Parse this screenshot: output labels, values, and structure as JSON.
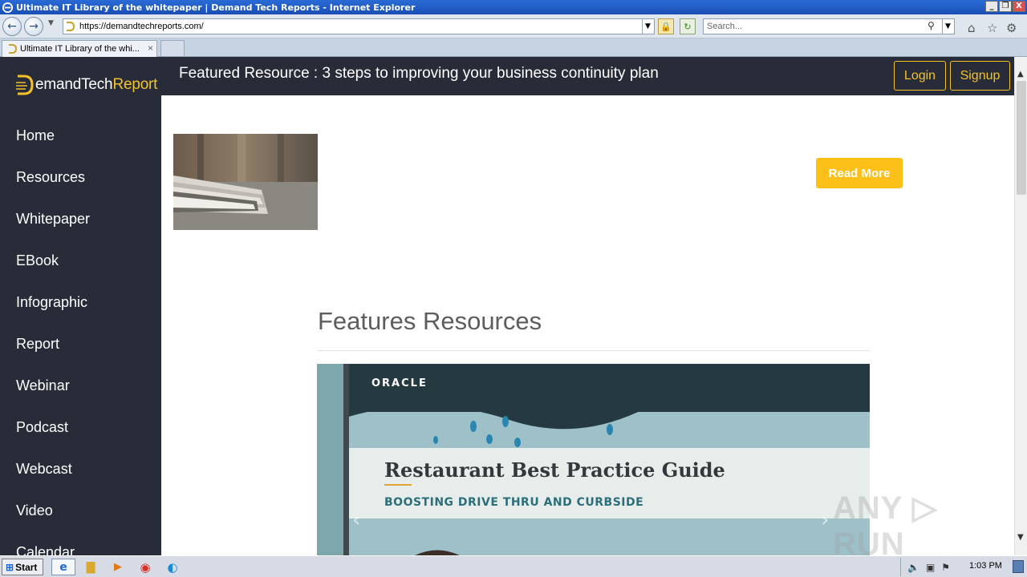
{
  "window": {
    "title": "Ultimate IT Library of the whitepaper | Demand Tech Reports - Internet Explorer",
    "min_label": "_",
    "restore_label": "❐",
    "close_label": "X"
  },
  "addressbar": {
    "back_label": "←",
    "forward_label": "→",
    "url": "https://demandtechreports.com/",
    "search_placeholder": "Search..."
  },
  "tab": {
    "title": "Ultimate IT Library of the whi...",
    "close_label": "×"
  },
  "site": {
    "brand_prefix": "emandTech",
    "brand_accent": "Report",
    "featured": "Featured Resource : 3 steps to improving your business continuity plan",
    "login_label": "Login",
    "signup_label": "Signup",
    "read_more_label": "Read More",
    "section_title": "Features Resources",
    "nav": [
      "Home",
      "Resources",
      "Whitepaper",
      "EBook",
      "Infographic",
      "Report",
      "Webinar",
      "Podcast",
      "Webcast",
      "Video",
      "Calendar"
    ]
  },
  "banner": {
    "brand": "ORACLE",
    "title": "Restaurant Best Practice Guide",
    "subtitle": "BOOSTING DRIVE THRU AND CURBSIDE"
  },
  "watermark": "ANY ▷ RUN",
  "taskbar": {
    "start_label": "Start",
    "clock": "1:03 PM"
  },
  "colors": {
    "sidebar": "#272c38",
    "accent": "#f3c22b",
    "read_more": "#fdc018",
    "ie_title": "#2a6bd6"
  }
}
